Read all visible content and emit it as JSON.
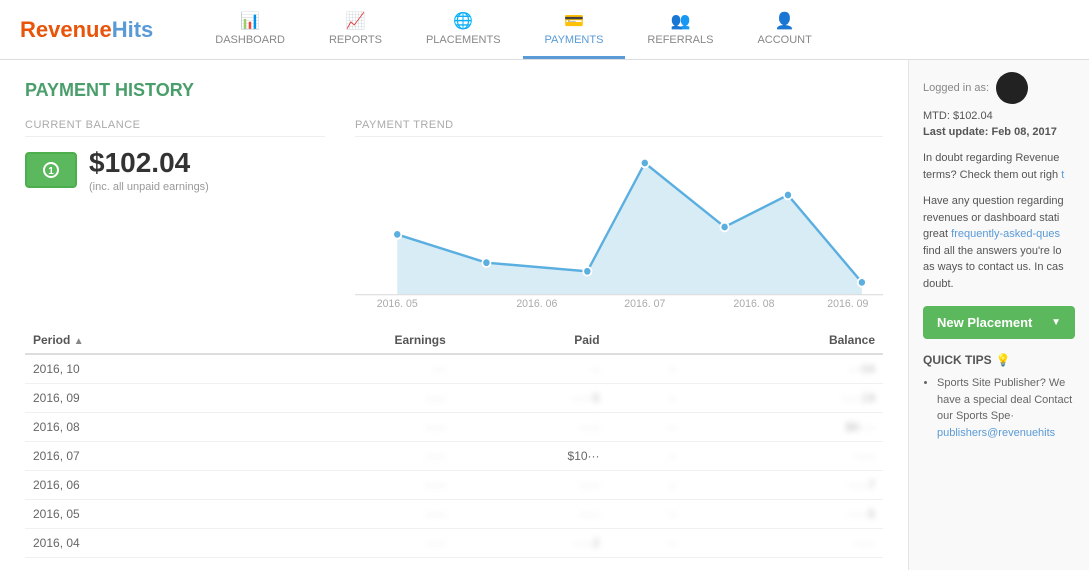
{
  "logo": {
    "part1": "Revenue",
    "part2": "Hits"
  },
  "nav": {
    "items": [
      {
        "id": "dashboard",
        "label": "DASHBOARD",
        "icon": "📊"
      },
      {
        "id": "reports",
        "label": "REPORTS",
        "icon": "📈"
      },
      {
        "id": "placements",
        "label": "PLACEMENTS",
        "icon": "🌐"
      },
      {
        "id": "payments",
        "label": "PAYMENTS",
        "icon": "💳",
        "active": true
      },
      {
        "id": "referrals",
        "label": "REFERRALS",
        "icon": "👥"
      },
      {
        "id": "account",
        "label": "ACCOUNT",
        "icon": "👤"
      }
    ]
  },
  "page": {
    "title": "PAYMENT HISTORY"
  },
  "balance": {
    "label": "CURRENT BALANCE",
    "amount": "$102.04",
    "note": "(inc. all unpaid earnings)"
  },
  "chart": {
    "label": "PAYMENT TREND",
    "x_labels": [
      "2016, 05",
      "2016, 06",
      "2016, 07",
      "2016, 08",
      "2016, 09"
    ],
    "points": [
      {
        "x": 0.08,
        "y": 0.55
      },
      {
        "x": 0.25,
        "y": 0.72
      },
      {
        "x": 0.44,
        "y": 0.78
      },
      {
        "x": 0.55,
        "y": 0.1
      },
      {
        "x": 0.7,
        "y": 0.5
      },
      {
        "x": 0.82,
        "y": 0.3
      },
      {
        "x": 0.96,
        "y": 0.85
      }
    ]
  },
  "table": {
    "columns": [
      "Period",
      "Earnings",
      "Paid",
      "",
      "Balance"
    ],
    "rows": [
      {
        "period": "2016, 10",
        "earnings": "···",
        "paid": "··",
        "col4": "··",
        "balance": "···04"
      },
      {
        "period": "2016, 09",
        "earnings": "·····",
        "paid": "·····5",
        "col4": "··",
        "balance": "·····19"
      },
      {
        "period": "2016, 08",
        "earnings": "·····",
        "paid": "·····",
        "col4": "··",
        "balance": "$6····"
      },
      {
        "period": "2016, 07",
        "earnings": "·····",
        "paid": "$10···",
        "col4": "··",
        "balance": "·····"
      },
      {
        "period": "2016, 06",
        "earnings": "·····",
        "paid": "·····",
        "col4": "··",
        "balance": "·····7"
      },
      {
        "period": "2016, 05",
        "earnings": "·····",
        "paid": "·····",
        "col4": "··",
        "balance": "·····5"
      },
      {
        "period": "2016, 04",
        "earnings": "·····",
        "paid": "·····2",
        "col4": "··",
        "balance": "·····"
      }
    ]
  },
  "sidebar": {
    "logged_in_label": "Logged in as:",
    "mtd_label": "MTD:",
    "mtd_value": "$102.04",
    "last_update_label": "Last update:",
    "last_update_value": "Feb 08, 2017",
    "info_text1": "In doubt regarding Revenue terms? Check them out righ",
    "info_text2": "Have any question regarding revenues or dashboard stati great",
    "faq_link": "frequently-asked-ques",
    "info_text3": "find all the answers you're lo as ways to contact us. In cas doubt.",
    "new_placement_label": "New Placement",
    "quick_tips_title": "QUICK TIPS",
    "tips": [
      {
        "text": "Sports Site Publisher? We have a special deal Contact our Sports Spe·",
        "link_text": "publishers@revenuehits"
      }
    ]
  }
}
